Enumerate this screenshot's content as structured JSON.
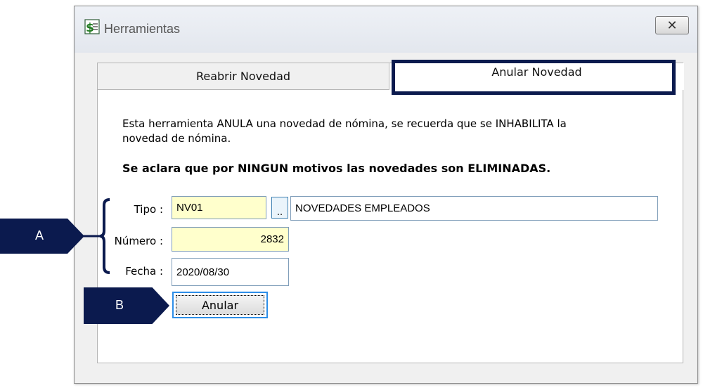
{
  "window": {
    "title": "Herramientas",
    "close_symbol": "✕"
  },
  "tabs": [
    {
      "label": "Reabrir Novedad",
      "active": false
    },
    {
      "label": "Anular Novedad",
      "active": true
    }
  ],
  "content": {
    "description": "Esta herramienta ANULA una novedad de nómina, se recuerda que se INHABILITA la novedad de nómina.",
    "warning": "Se aclara que por NINGUN motivos las novedades son ELIMINADAS."
  },
  "form": {
    "tipo_label": "Tipo :",
    "tipo_code": "NV01",
    "lookup_label": "..",
    "tipo_description": "NOVEDADES EMPLEADOS",
    "numero_label": "Número :",
    "numero_value": "2832",
    "fecha_label": "Fecha :",
    "fecha_value": "2020/08/30"
  },
  "actions": {
    "anular_label": "Anular"
  },
  "annotations": {
    "a_label": "A",
    "b_label": "B",
    "color": "#0b1a4e"
  },
  "icons": {
    "app": "spreadsheet-icon",
    "close": "close-icon",
    "lookup": "ellipsis-icon"
  }
}
